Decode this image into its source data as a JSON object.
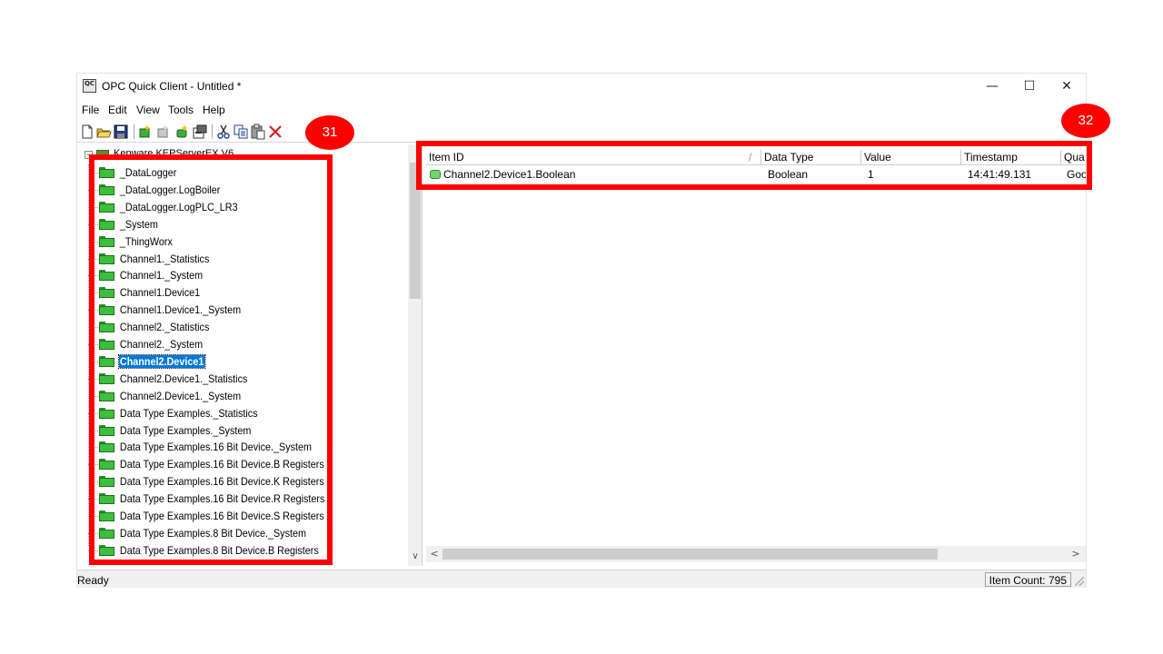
{
  "window": {
    "title": "OPC Quick Client - Untitled *",
    "app_icon_text": "QC",
    "controls": {
      "minimize": "—",
      "maximize": "☐",
      "close": "✕"
    }
  },
  "menu": [
    "File",
    "Edit",
    "View",
    "Tools",
    "Help"
  ],
  "toolbar": [
    "new-icon",
    "open-icon",
    "save-icon",
    "new-server-icon",
    "new-group-icon",
    "new-item-icon",
    "properties-icon",
    "cut-icon",
    "copy-icon",
    "paste-icon",
    "delete-icon"
  ],
  "tree": {
    "root_label": "Kepware.KEPServerEX.V6",
    "selected_index": 11,
    "items": [
      "_DataLogger",
      "_DataLogger.LogBoiler",
      "_DataLogger.LogPLC_LR3",
      "_System",
      "_ThingWorx",
      "Channel1._Statistics",
      "Channel1._System",
      "Channel1.Device1",
      "Channel1.Device1._System",
      "Channel2._Statistics",
      "Channel2._System",
      "Channel2.Device1",
      "Channel2.Device1._Statistics",
      "Channel2.Device1._System",
      "Data Type Examples._Statistics",
      "Data Type Examples._System",
      "Data Type Examples.16 Bit Device._System",
      "Data Type Examples.16 Bit Device.B Registers",
      "Data Type Examples.16 Bit Device.K Registers",
      "Data Type Examples.16 Bit Device.R Registers",
      "Data Type Examples.16 Bit Device.S Registers",
      "Data Type Examples.8 Bit Device._System",
      "Data Type Examples.8 Bit Device.B Registers"
    ]
  },
  "list": {
    "columns": [
      "Item ID",
      "Data Type",
      "Value",
      "Timestamp",
      "Qua"
    ],
    "rows": [
      {
        "item_id": "Channel2.Device1.Boolean",
        "data_type": "Boolean",
        "value": "1",
        "timestamp": "14:41:49.131",
        "quality": "Goo"
      }
    ]
  },
  "status": {
    "left": "Ready",
    "item_count": "Item Count: 795"
  },
  "annotations": {
    "badge_left": "31",
    "badge_right": "32",
    "highlight_color": "#ff0000"
  }
}
